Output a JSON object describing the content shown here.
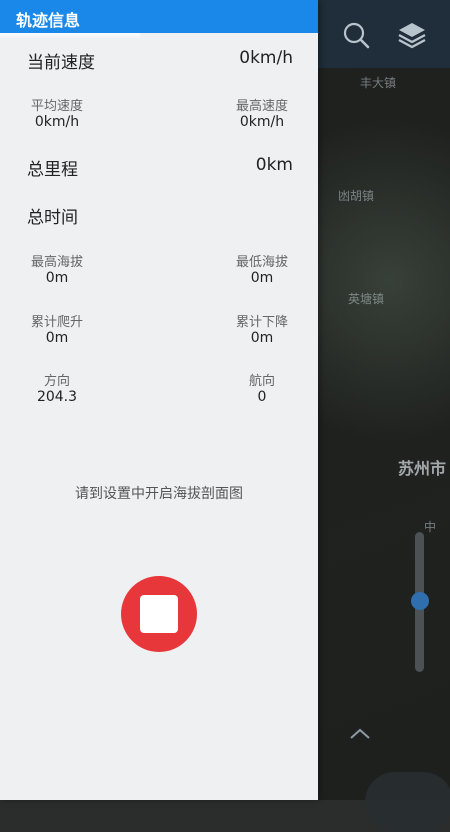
{
  "panel": {
    "title": "轨迹信息",
    "current_speed": {
      "label": "当前速度",
      "value": "0km/h"
    },
    "avg_speed": {
      "label": "平均速度",
      "value": "0km/h"
    },
    "max_speed": {
      "label": "最高速度",
      "value": "0km/h"
    },
    "total_distance": {
      "label": "总里程",
      "value": "0km"
    },
    "total_time": {
      "label": "总时间",
      "value": ""
    },
    "max_altitude": {
      "label": "最高海拔",
      "value": "0m"
    },
    "min_altitude": {
      "label": "最低海拔",
      "value": "0m"
    },
    "total_climb": {
      "label": "累计爬升",
      "value": "0m"
    },
    "total_descent": {
      "label": "累计下降",
      "value": "0m"
    },
    "direction": {
      "label": "方向",
      "value": "204.3"
    },
    "heading": {
      "label": "航向",
      "value": "0"
    },
    "altitude_hint": "请到设置中开启海拔剖面图"
  },
  "map": {
    "labels": [
      "丰大镇",
      "凼胡镇",
      "英塘镇",
      "苏州市",
      "中"
    ],
    "icons": [
      "search-icon",
      "layers-icon",
      "chevron-up-icon",
      "stop-icon"
    ]
  },
  "colors": {
    "header": "#1a88e8",
    "stop_button": "#e8373a",
    "panel_bg": "#eff0f2"
  }
}
